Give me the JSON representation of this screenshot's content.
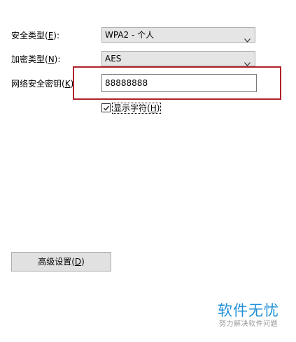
{
  "security_type": {
    "label_text": "安全类型(",
    "accel": "E",
    "label_suffix": "):",
    "value": "WPA2 - 个人"
  },
  "encryption_type": {
    "label_text": "加密类型(",
    "accel": "N",
    "label_suffix": "):",
    "value": "AES"
  },
  "network_key": {
    "label_text": "网络安全密钥(",
    "accel": "K",
    "label_suffix": ")",
    "value": "88888888"
  },
  "show_chars": {
    "label_text": "显示字符(",
    "accel": "H",
    "label_suffix": ")",
    "checked": true
  },
  "advanced_button": {
    "label_text": "高级设置(",
    "accel": "D",
    "label_suffix": ")"
  },
  "watermark": {
    "title": "软件无忧",
    "subtitle": "努力解决软件问题"
  },
  "colors": {
    "highlight_border": "#b0222a",
    "watermark_blue": "#1e8fd6"
  },
  "icons": {
    "dropdown": "chevron-down-icon",
    "checkbox": "checkmark-icon"
  }
}
